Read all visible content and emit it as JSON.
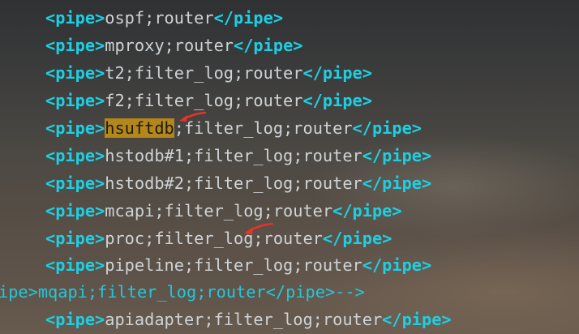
{
  "editor": {
    "open_tag": "<pipe>",
    "close_tag": "</pipe>",
    "lines": [
      {
        "content": "ospf;router"
      },
      {
        "content": "mproxy;router"
      },
      {
        "content": "t2;filter_log;router"
      },
      {
        "content": "f2;filter_log;router"
      },
      {
        "highlight": "hsuftdb",
        "content": ";filter_log;router"
      },
      {
        "content": "hstodb#1;filter_log;router"
      },
      {
        "content": "hstodb#2;filter_log;router"
      },
      {
        "content": "mcapi;filter_log;router"
      },
      {
        "content": "proc;filter_log;router"
      },
      {
        "content": "pipeline;filter_log;router"
      },
      {
        "comment_text": "ipe>mqapi;filter_log;router</pipe>-->"
      },
      {
        "content": "apiadapter;filter_log;router"
      }
    ]
  },
  "annotations": {
    "arrow_color": "#e8322a"
  }
}
